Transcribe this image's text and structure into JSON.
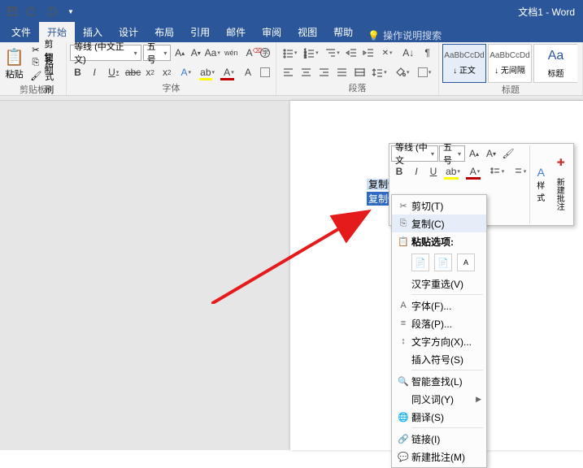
{
  "titlebar": {
    "doc_title": "文档1 - Word"
  },
  "tabs": {
    "file": "文件",
    "home": "开始",
    "insert": "插入",
    "design": "设计",
    "layout": "布局",
    "references": "引用",
    "mailings": "邮件",
    "review": "审阅",
    "view": "视图",
    "help": "帮助",
    "tell_me": "操作说明搜索"
  },
  "groups": {
    "clipboard": {
      "label": "剪贴板",
      "paste": "粘贴",
      "cut": "剪切",
      "copy": "复制",
      "format_painter": "格式刷"
    },
    "font": {
      "label": "字体",
      "name": "等线 (中文正文)",
      "size": "五号"
    },
    "paragraph": {
      "label": "段落"
    },
    "styles": {
      "label": "标题",
      "items": [
        {
          "preview": "AaBbCcDd",
          "name": "↓ 正文"
        },
        {
          "preview": "AaBbCcDd",
          "name": "↓ 无间隔"
        },
        {
          "preview": "Aa",
          "name": "标题"
        }
      ]
    }
  },
  "mini_toolbar": {
    "font_name": "等线 (中文",
    "font_size": "五号",
    "styles_label": "样式",
    "new_comment": "新建\n批注"
  },
  "selected_text": {
    "line1": "复制快",
    "line2": "复制快捷键是什么"
  },
  "context_menu": {
    "cut": "剪切(T)",
    "copy": "复制(C)",
    "paste_label": "粘贴选项:",
    "chinese_reselect": "汉字重选(V)",
    "font": "字体(F)...",
    "paragraph": "段落(P)...",
    "text_direction": "文字方向(X)...",
    "insert_symbol": "插入符号(S)",
    "smart_lookup": "智能查找(L)",
    "synonyms": "同义词(Y)",
    "translate": "翻译(S)",
    "link": "链接(I)",
    "new_comment": "新建批注(M)"
  }
}
